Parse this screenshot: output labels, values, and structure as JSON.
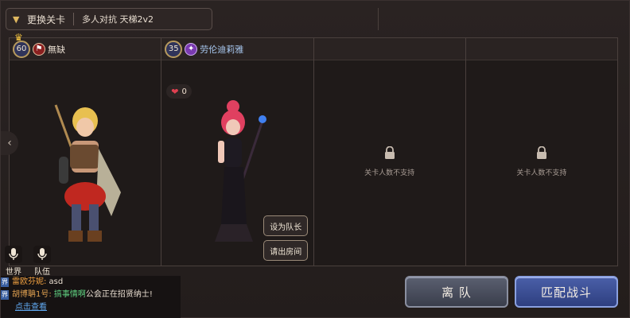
{
  "stage": {
    "change_label": "更换关卡",
    "name": "多人对抗 天梯2v2"
  },
  "slots": [
    {
      "level": "60",
      "name": "無缺",
      "class_icon": "shield-class-icon",
      "is_leader": true
    },
    {
      "level": "35",
      "name": "劳伦迪莉雅",
      "class_icon": "wand-class-icon",
      "likes": "0",
      "set_leader_label": "设为队长",
      "kick_label": "请出房间"
    },
    {
      "locked_text": "关卡人数不支持"
    },
    {
      "locked_text": "关卡人数不支持"
    }
  ],
  "voice": {
    "world_label": "世界",
    "team_label": "队伍"
  },
  "chat": {
    "lines": [
      {
        "tag": "界",
        "speaker": "雷欧芬妮:",
        "text": " asd"
      },
      {
        "tag": "界",
        "speaker": "胡博聃1号:",
        "highlight": " 搞事情啊",
        "text": "公会正在招贤纳士!"
      }
    ],
    "link": "点击查看"
  },
  "buttons": {
    "leave": "离 队",
    "match": "匹配战斗"
  },
  "colors": {
    "match_button": "#2e3f80",
    "leave_button": "#3a3e4c",
    "accent_gold": "#b79a5e"
  }
}
